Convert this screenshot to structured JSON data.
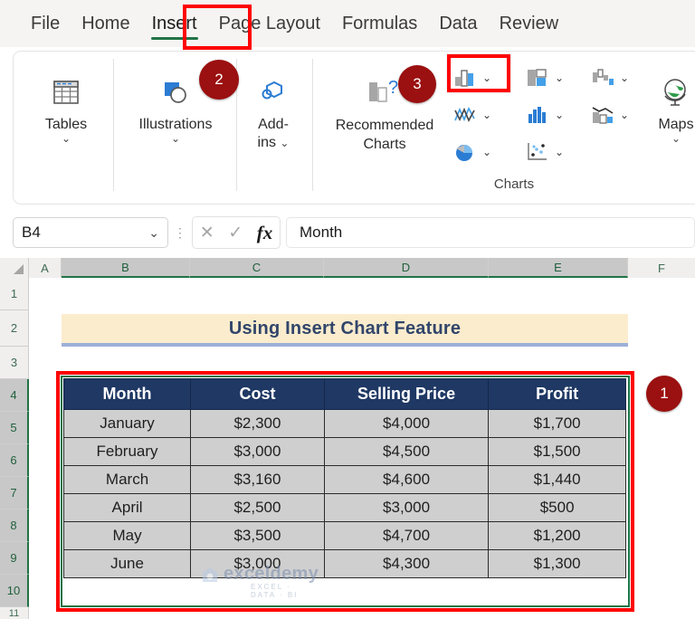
{
  "ribbon": {
    "tabs": [
      {
        "label": "File",
        "active": false
      },
      {
        "label": "Home",
        "active": false
      },
      {
        "label": "Insert",
        "active": true
      },
      {
        "label": "Page Layout",
        "active": false
      },
      {
        "label": "Formulas",
        "active": false
      },
      {
        "label": "Data",
        "active": false
      },
      {
        "label": "Review",
        "active": false
      }
    ],
    "groups": {
      "tables": {
        "label": "Tables",
        "icon": "table-icon",
        "chevron": "⌄"
      },
      "illustrations": {
        "label": "Illustrations",
        "icon": "illustrations-icon",
        "chevron": "⌄"
      },
      "addins": {
        "label_line1": "Add-",
        "label_line2": "ins",
        "icon": "add-ins-icon",
        "chevron": "⌄"
      },
      "recommended_charts": {
        "label_line1": "Recommended",
        "label_line2": "Charts",
        "icon": "recommended-charts-icon"
      },
      "charts": {
        "label": "Charts",
        "buttons": [
          {
            "name": "column-bar-chart-button",
            "chevron": "⌄"
          },
          {
            "name": "hierarchy-chart-button",
            "chevron": "⌄"
          },
          {
            "name": "waterfall-chart-button",
            "chevron": "⌄"
          },
          {
            "name": "line-area-chart-button",
            "chevron": "⌄"
          },
          {
            "name": "statistic-chart-button",
            "chevron": "⌄"
          },
          {
            "name": "combo-chart-button",
            "chevron": "⌄"
          },
          {
            "name": "pie-doughnut-chart-button",
            "chevron": "⌄"
          },
          {
            "name": "scatter-chart-button",
            "chevron": "⌄"
          }
        ]
      },
      "maps": {
        "label": "Maps",
        "icon": "globe-icon",
        "chevron": "⌄"
      }
    }
  },
  "callouts": [
    {
      "number": "1",
      "target": "data-range-selection"
    },
    {
      "number": "2",
      "target": "ribbon-insert-group"
    },
    {
      "number": "3",
      "target": "charts-group"
    }
  ],
  "formula_bar": {
    "name_box_value": "B4",
    "name_box_chevron": "⌄",
    "cancel_icon": "✕",
    "enter_icon": "✓",
    "fx_label": "fx",
    "formula_value": "Month"
  },
  "grid": {
    "columns": [
      "A",
      "B",
      "C",
      "D",
      "E",
      "F"
    ],
    "selected_columns": [
      "B",
      "C",
      "D",
      "E"
    ],
    "rows": [
      "1",
      "2",
      "3",
      "4",
      "5",
      "6",
      "7",
      "8",
      "9",
      "10",
      "11"
    ],
    "selected_rows": [
      "4",
      "5",
      "6",
      "7",
      "8",
      "9",
      "10"
    ],
    "title_banner": "Using Insert Chart Feature"
  },
  "table": {
    "headers": [
      "Month",
      "Cost",
      "Selling Price",
      "Profit"
    ],
    "rows": [
      [
        "January",
        "$2,300",
        "$4,000",
        "$1,700"
      ],
      [
        "February",
        "$3,000",
        "$4,500",
        "$1,500"
      ],
      [
        "March",
        "$3,160",
        "$4,600",
        "$1,440"
      ],
      [
        "April",
        "$2,500",
        "$3,000",
        "$500"
      ],
      [
        "May",
        "$3,500",
        "$4,700",
        "$1,200"
      ],
      [
        "June",
        "$3,000",
        "$4,300",
        "$1,300"
      ]
    ]
  },
  "watermark": {
    "text": "exceldemy",
    "subtext": "EXCEL · DATA · BI"
  },
  "colors": {
    "accent_green": "#217346",
    "highlight_red": "#ff0000",
    "badge_red": "#9b1010",
    "table_header_bg": "#1f3864",
    "table_cell_bg": "#cfcfcf",
    "banner_bg": "#fbeccd",
    "banner_text": "#31456b"
  }
}
